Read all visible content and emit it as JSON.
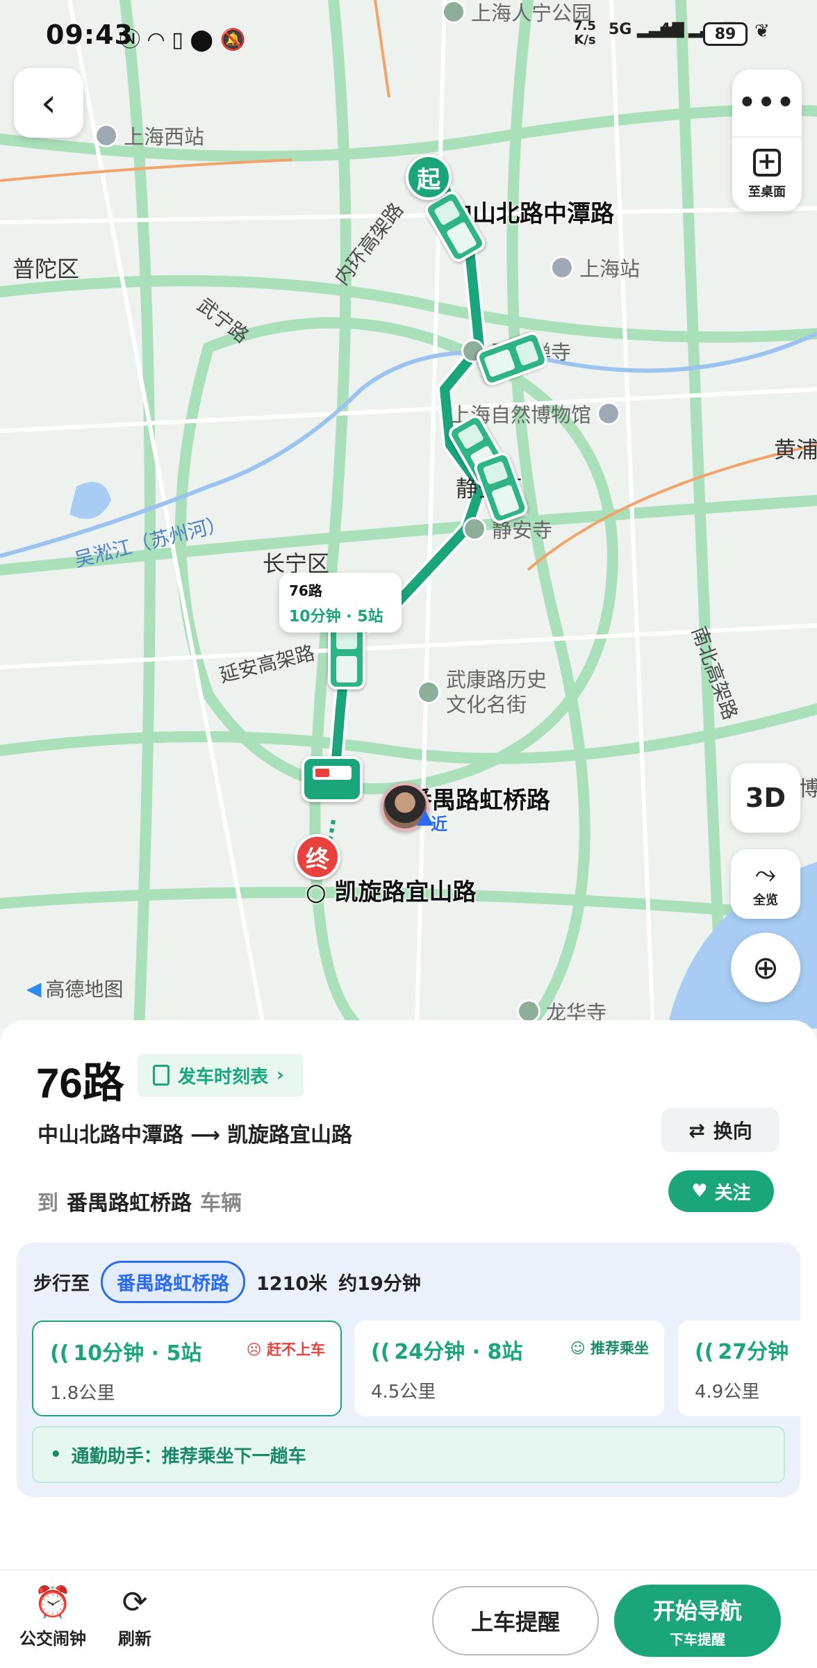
{
  "status_bar": {
    "time": "09:43",
    "net_speed": "7.5\nK/s",
    "signal1": "5G",
    "signal2": "4G",
    "battery": "89"
  },
  "map": {
    "labels": {
      "shanghai_west": "上海西站",
      "putuo": "普陀区",
      "inner_ring": "内环高架路",
      "wuning": "武宁路",
      "zhongshan_tanzi": "中山北路中潭路",
      "shanghai_station": "上海站",
      "yufo": "玉佛禅寺",
      "museum": "上海自然博物馆",
      "jingan_district": "静安区",
      "jingan_temple": "静安寺",
      "huangpu": "黄浦",
      "wusong": "吴淞江（苏州河）",
      "changning": "长宁区",
      "yanan": "延安高架路",
      "wukang": "武康路历史\n文化名街",
      "nanbei": "南北高架路",
      "panyu_hongqiao": "番禺路虹桥路",
      "kaixuan_yishan": "凯旋路宜山路",
      "longhua": "龙华寺",
      "near": "近",
      "park": "上海人宁公园",
      "bo": "博"
    },
    "callout": {
      "route": "76路",
      "eta": "10分钟 · 5站"
    },
    "start_pin": "起",
    "end_pin": "终",
    "logo": "高德地图",
    "btn_desktop": "至桌面",
    "btn_3d": "3D",
    "btn_overview": "全览"
  },
  "panel": {
    "route_name": "76路",
    "timetable": "发车时刻表",
    "from": "中山北路中潭路",
    "to": "凯旋路宜山路",
    "reverse": "换向",
    "dest_prefix": "到",
    "dest_stop": "番禺路虹桥路",
    "dest_suffix": "车辆",
    "follow": "关注",
    "walk": {
      "prefix": "步行至",
      "stop": "番禺路虹桥路",
      "distance": "1210米",
      "time": "约19分钟"
    },
    "arrivals": [
      {
        "eta": "10分钟 · 5站",
        "tag": "赶不上车",
        "dist": "1.8公里"
      },
      {
        "eta": "24分钟 · 8站",
        "tag": "推荐乘坐",
        "dist": "4.5公里"
      },
      {
        "eta": "27分钟",
        "tag": "",
        "dist": "4.9公里"
      }
    ],
    "assistant": "通勤助手：推荐乘坐下一趟车"
  },
  "bottom": {
    "alarm": "公交闹钟",
    "refresh": "刷新",
    "board_remind": "上车提醒",
    "start_nav": "开始导航",
    "alight_remind": "下车提醒"
  },
  "colors": {
    "accent": "#1aa57a",
    "route": "#1aa57a",
    "danger": "#e8413e",
    "walk_blue": "#2a6bf0"
  }
}
